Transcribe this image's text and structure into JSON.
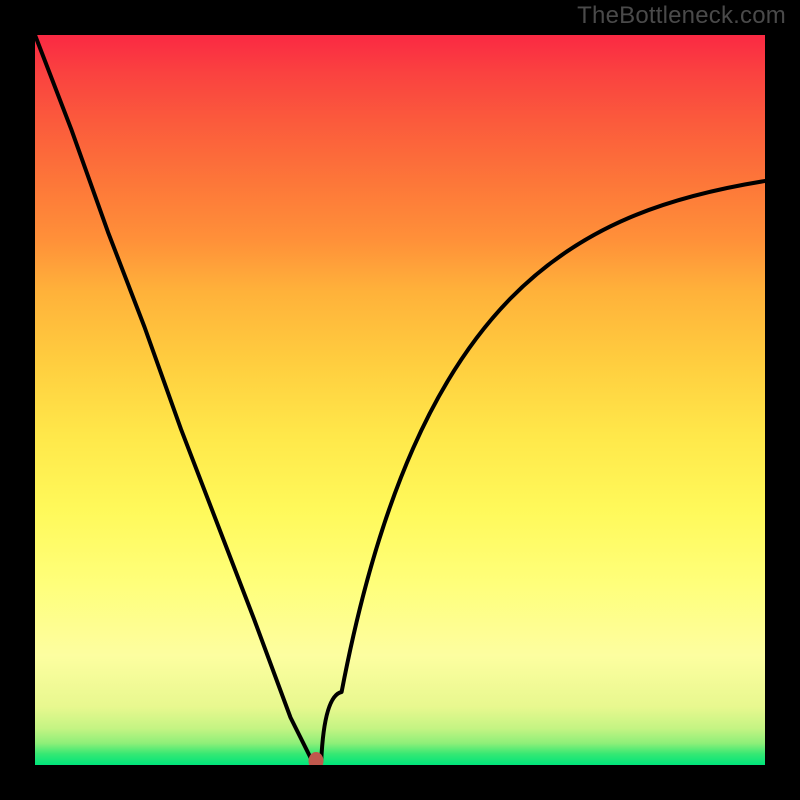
{
  "watermark": "TheBottleneck.com",
  "chart_data": {
    "type": "line",
    "title": "",
    "xlabel": "",
    "ylabel": "",
    "xlim": [
      0,
      100
    ],
    "ylim": [
      0,
      100
    ],
    "grid": false,
    "legend": false,
    "background": "rainbow-gradient-red-to-green",
    "annotations": [],
    "series": [
      {
        "name": "bottleneck-curve",
        "x": [
          0,
          5,
          10,
          15,
          20,
          25,
          30,
          35,
          38,
          40,
          41,
          42,
          100
        ],
        "values": [
          100,
          87,
          73,
          60,
          46,
          33,
          20,
          6.5,
          0.5,
          3,
          6,
          10,
          80
        ]
      }
    ],
    "marker": {
      "x": 38.5,
      "y": 0.5,
      "color": "#c1584d"
    },
    "colors": {
      "curve": "#000000",
      "frame": "#000000",
      "gradient_top": "#fa2943",
      "gradient_bottom": "#00e57b"
    }
  }
}
